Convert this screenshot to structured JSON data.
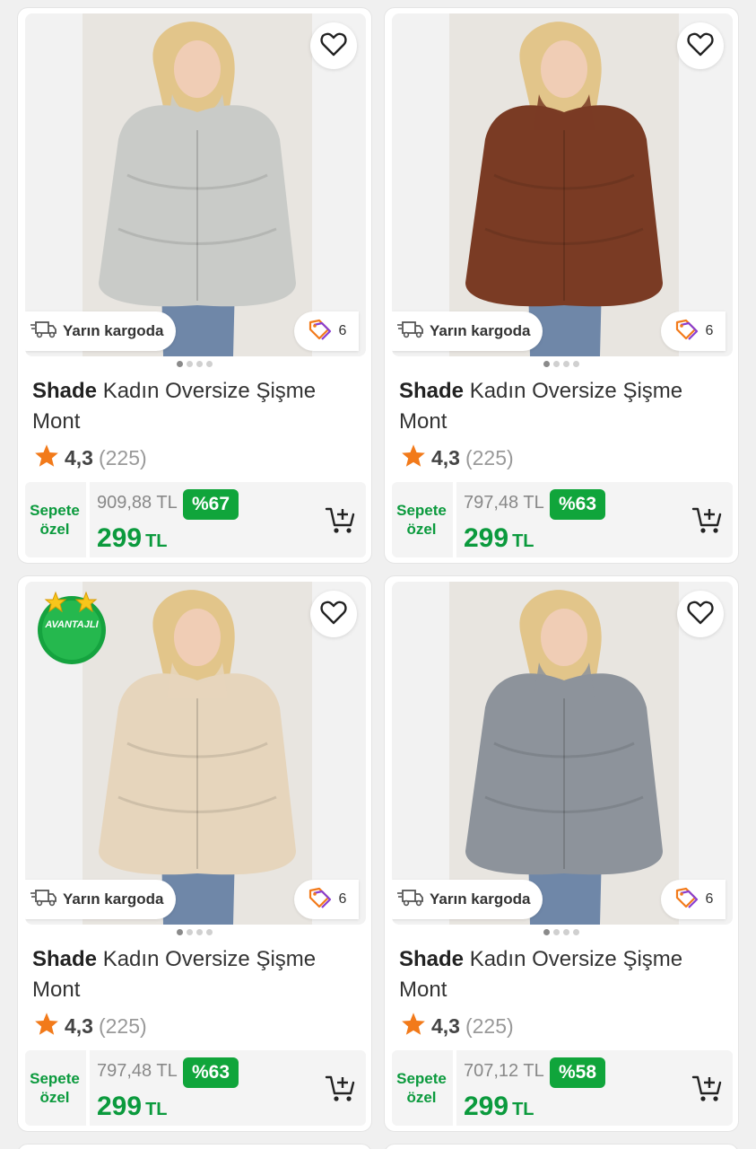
{
  "products": [
    {
      "brand": "Shade",
      "name": "Kadın Oversize Şişme Mont",
      "rating": "4,3",
      "review_count": "(225)",
      "shipping_label": "Yarın kargoda",
      "color_count": "6",
      "basket_label_1": "Sepete",
      "basket_label_2": "özel",
      "old_price": "909,88 TL",
      "discount": "%67",
      "price": "299",
      "currency": "TL",
      "jacket_color": "#c9cbc8",
      "badge": ""
    },
    {
      "brand": "Shade",
      "name": "Kadın Oversize Şişme Mont",
      "rating": "4,3",
      "review_count": "(225)",
      "shipping_label": "Yarın kargoda",
      "color_count": "6",
      "basket_label_1": "Sepete",
      "basket_label_2": "özel",
      "old_price": "797,48 TL",
      "discount": "%63",
      "price": "299",
      "currency": "TL",
      "jacket_color": "#7a3b24",
      "badge": ""
    },
    {
      "brand": "Shade",
      "name": "Kadın Oversize Şişme Mont",
      "rating": "4,3",
      "review_count": "(225)",
      "shipping_label": "Yarın kargoda",
      "color_count": "6",
      "basket_label_1": "Sepete",
      "basket_label_2": "özel",
      "old_price": "797,48 TL",
      "discount": "%63",
      "price": "299",
      "currency": "TL",
      "jacket_color": "#e6d5bc",
      "badge": "AVANTAJLI"
    },
    {
      "brand": "Shade",
      "name": "Kadın Oversize Şişme Mont",
      "rating": "4,3",
      "review_count": "(225)",
      "shipping_label": "Yarın kargoda",
      "color_count": "6",
      "basket_label_1": "Sepete",
      "basket_label_2": "özel",
      "old_price": "707,12 TL",
      "discount": "%58",
      "price": "299",
      "currency": "TL",
      "jacket_color": "#8d939b",
      "badge": ""
    }
  ],
  "icons": {
    "favorite": "heart-outline-icon",
    "shipping": "delivery-truck-icon",
    "colors": "color-tags-icon",
    "rating": "star-icon",
    "cart": "add-to-cart-icon"
  },
  "colors": {
    "accent_green": "#0b9a3d",
    "discount_green": "#10a53b",
    "star_orange": "#f27a1a"
  }
}
